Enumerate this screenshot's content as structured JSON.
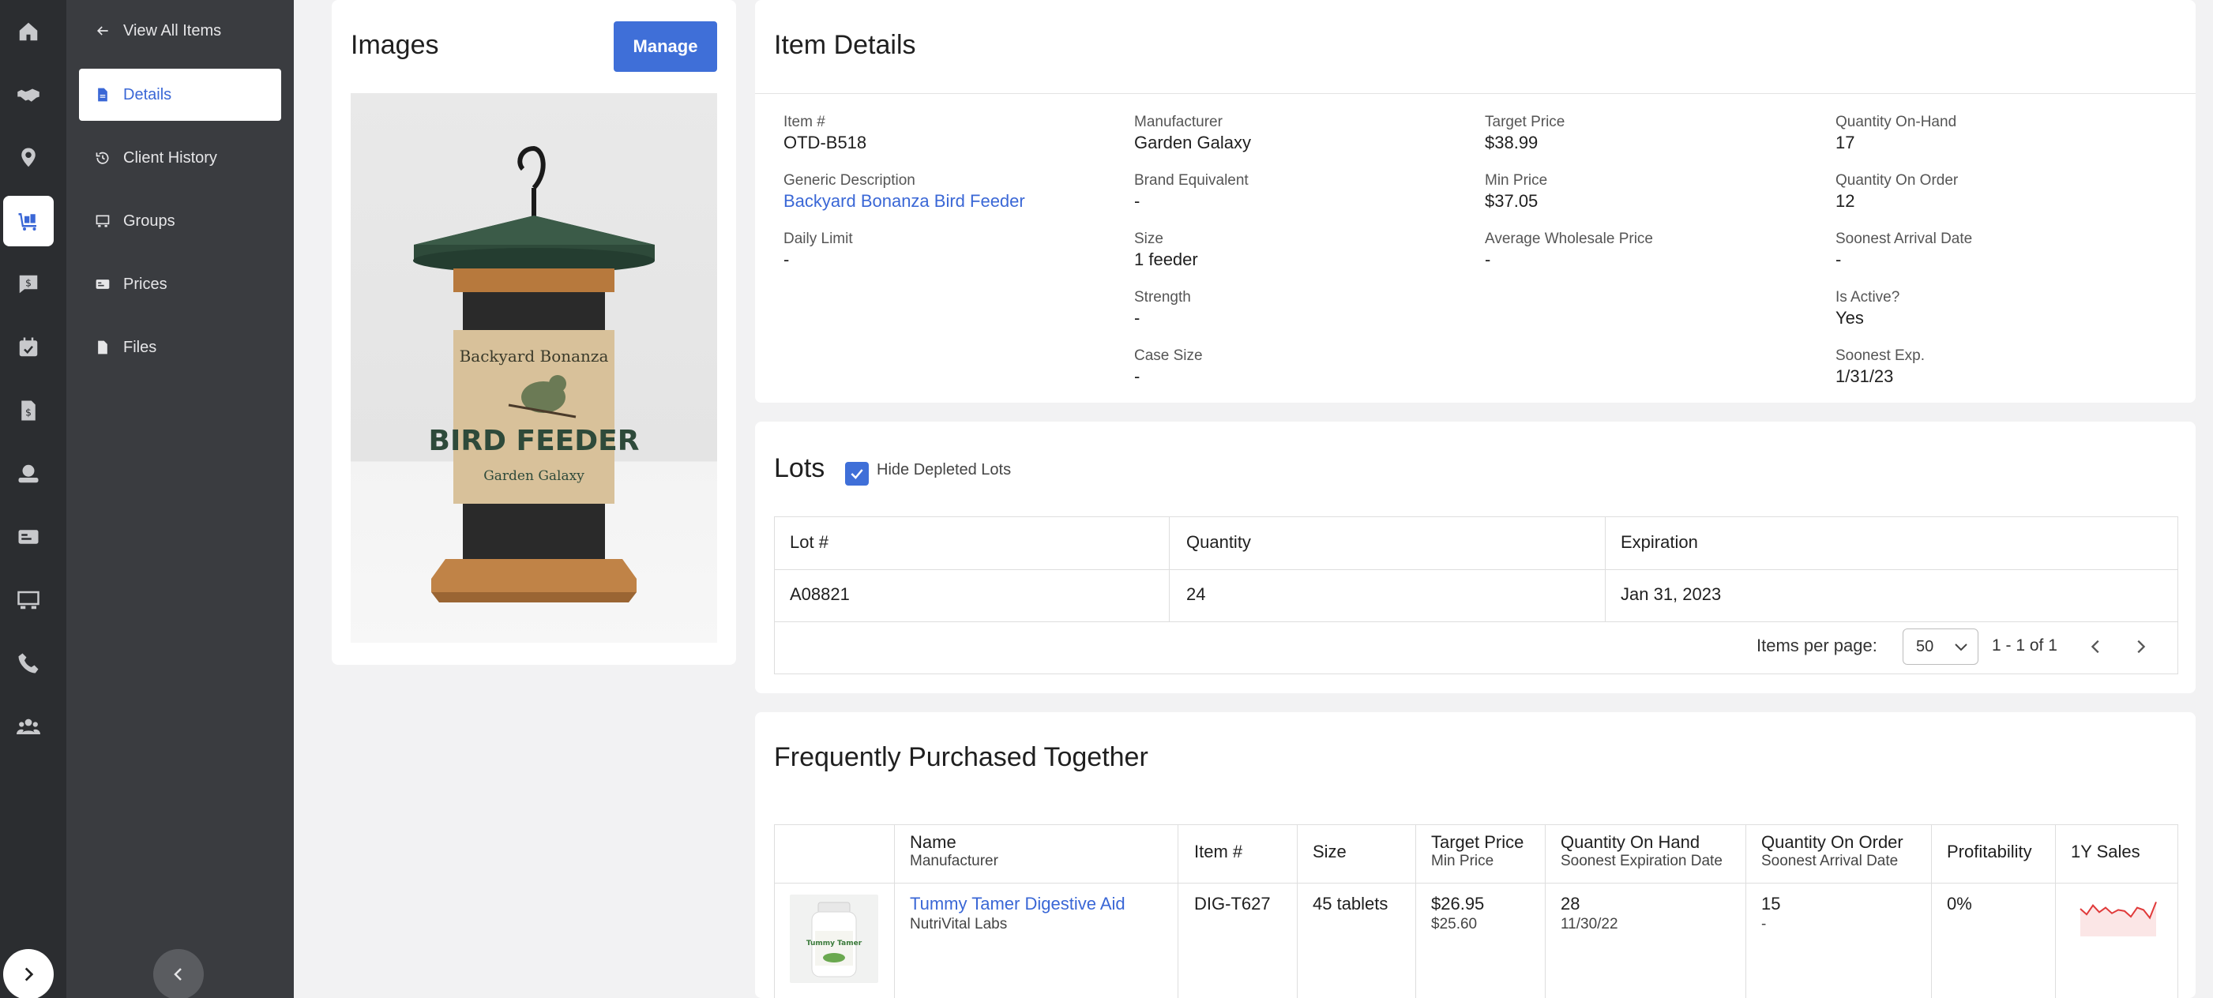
{
  "rail": {
    "icons": [
      "home-icon",
      "handshake-icon",
      "location-pin-icon",
      "inventory-cart-icon",
      "chat-money-icon",
      "calendar-check-icon",
      "invoice-icon",
      "money-hand-icon",
      "card-icon",
      "storefront-icon",
      "phone-icon",
      "people-icon"
    ],
    "active": "inventory-cart-icon"
  },
  "subnav": {
    "back_label": "View All Items",
    "items": [
      {
        "label": "Details",
        "icon": "document-icon",
        "active": true
      },
      {
        "label": "Client History",
        "icon": "history-icon",
        "active": false
      },
      {
        "label": "Groups",
        "icon": "groups-icon",
        "active": false
      },
      {
        "label": "Prices",
        "icon": "price-tag-icon",
        "active": false
      },
      {
        "label": "Files",
        "icon": "file-icon",
        "active": false
      }
    ]
  },
  "images": {
    "title": "Images",
    "manage_label": "Manage",
    "product_label_top": "Backyard Bonanza",
    "product_label_main": "BIRD FEEDER",
    "product_label_brand": "Garden Galaxy"
  },
  "details": {
    "title": "Item Details",
    "col1": [
      {
        "label": "Item #",
        "value": "OTD-B518"
      },
      {
        "label": "Generic Description",
        "value": "Backyard Bonanza Bird Feeder",
        "link": true
      },
      {
        "label": "Daily Limit",
        "value": "-"
      }
    ],
    "col2": [
      {
        "label": "Manufacturer",
        "value": "Garden Galaxy"
      },
      {
        "label": "Brand Equivalent",
        "value": "-"
      },
      {
        "label": "Size",
        "value": "1 feeder"
      },
      {
        "label": "Strength",
        "value": "-"
      },
      {
        "label": "Case Size",
        "value": "-"
      }
    ],
    "col3": [
      {
        "label": "Target Price",
        "value": "$38.99"
      },
      {
        "label": "Min Price",
        "value": "$37.05"
      },
      {
        "label": "Average Wholesale Price",
        "value": "-"
      }
    ],
    "col4": [
      {
        "label": "Quantity On-Hand",
        "value": "17"
      },
      {
        "label": "Quantity On Order",
        "value": "12"
      },
      {
        "label": "Soonest Arrival Date",
        "value": "-"
      },
      {
        "label": "Is Active?",
        "value": "Yes"
      },
      {
        "label": "Soonest Exp.",
        "value": "1/31/23"
      }
    ]
  },
  "lots": {
    "title": "Lots",
    "hide_depleted_label": "Hide Depleted Lots",
    "hide_depleted_checked": true,
    "columns": [
      "Lot #",
      "Quantity",
      "Expiration"
    ],
    "rows": [
      [
        "A08821",
        "24",
        "Jan 31, 2023"
      ]
    ],
    "items_per_page_label": "Items per page:",
    "items_per_page_value": "50",
    "range_label": "1 - 1 of 1"
  },
  "fpt": {
    "title": "Frequently Purchased Together",
    "columns": {
      "name": "Name",
      "name_sub": "Manufacturer",
      "item": "Item #",
      "size": "Size",
      "target": "Target Price",
      "target_sub": "Min Price",
      "qoh": "Quantity On Hand",
      "qoh_sub": "Soonest Expiration Date",
      "qoo": "Quantity On Order",
      "qoo_sub": "Soonest Arrival Date",
      "profit": "Profitability",
      "sales": "1Y Sales"
    },
    "rows": [
      {
        "name": "Tummy Tamer Digestive Aid",
        "manufacturer": "NutriVital Labs",
        "item": "DIG-T627",
        "size": "45 tablets",
        "target": "$26.95",
        "min": "$25.60",
        "qoh": "28",
        "soonest_exp": "11/30/22",
        "qoo": "15",
        "soonest_arrival": "-",
        "profit": "0%",
        "sparkline": [
          0.55,
          0.3,
          0.7,
          0.4,
          0.6,
          0.35,
          0.5,
          0.45,
          0.2,
          0.6,
          0.5,
          0.15,
          0.85
        ],
        "image_text": "Tummy Tamer"
      }
    ]
  }
}
